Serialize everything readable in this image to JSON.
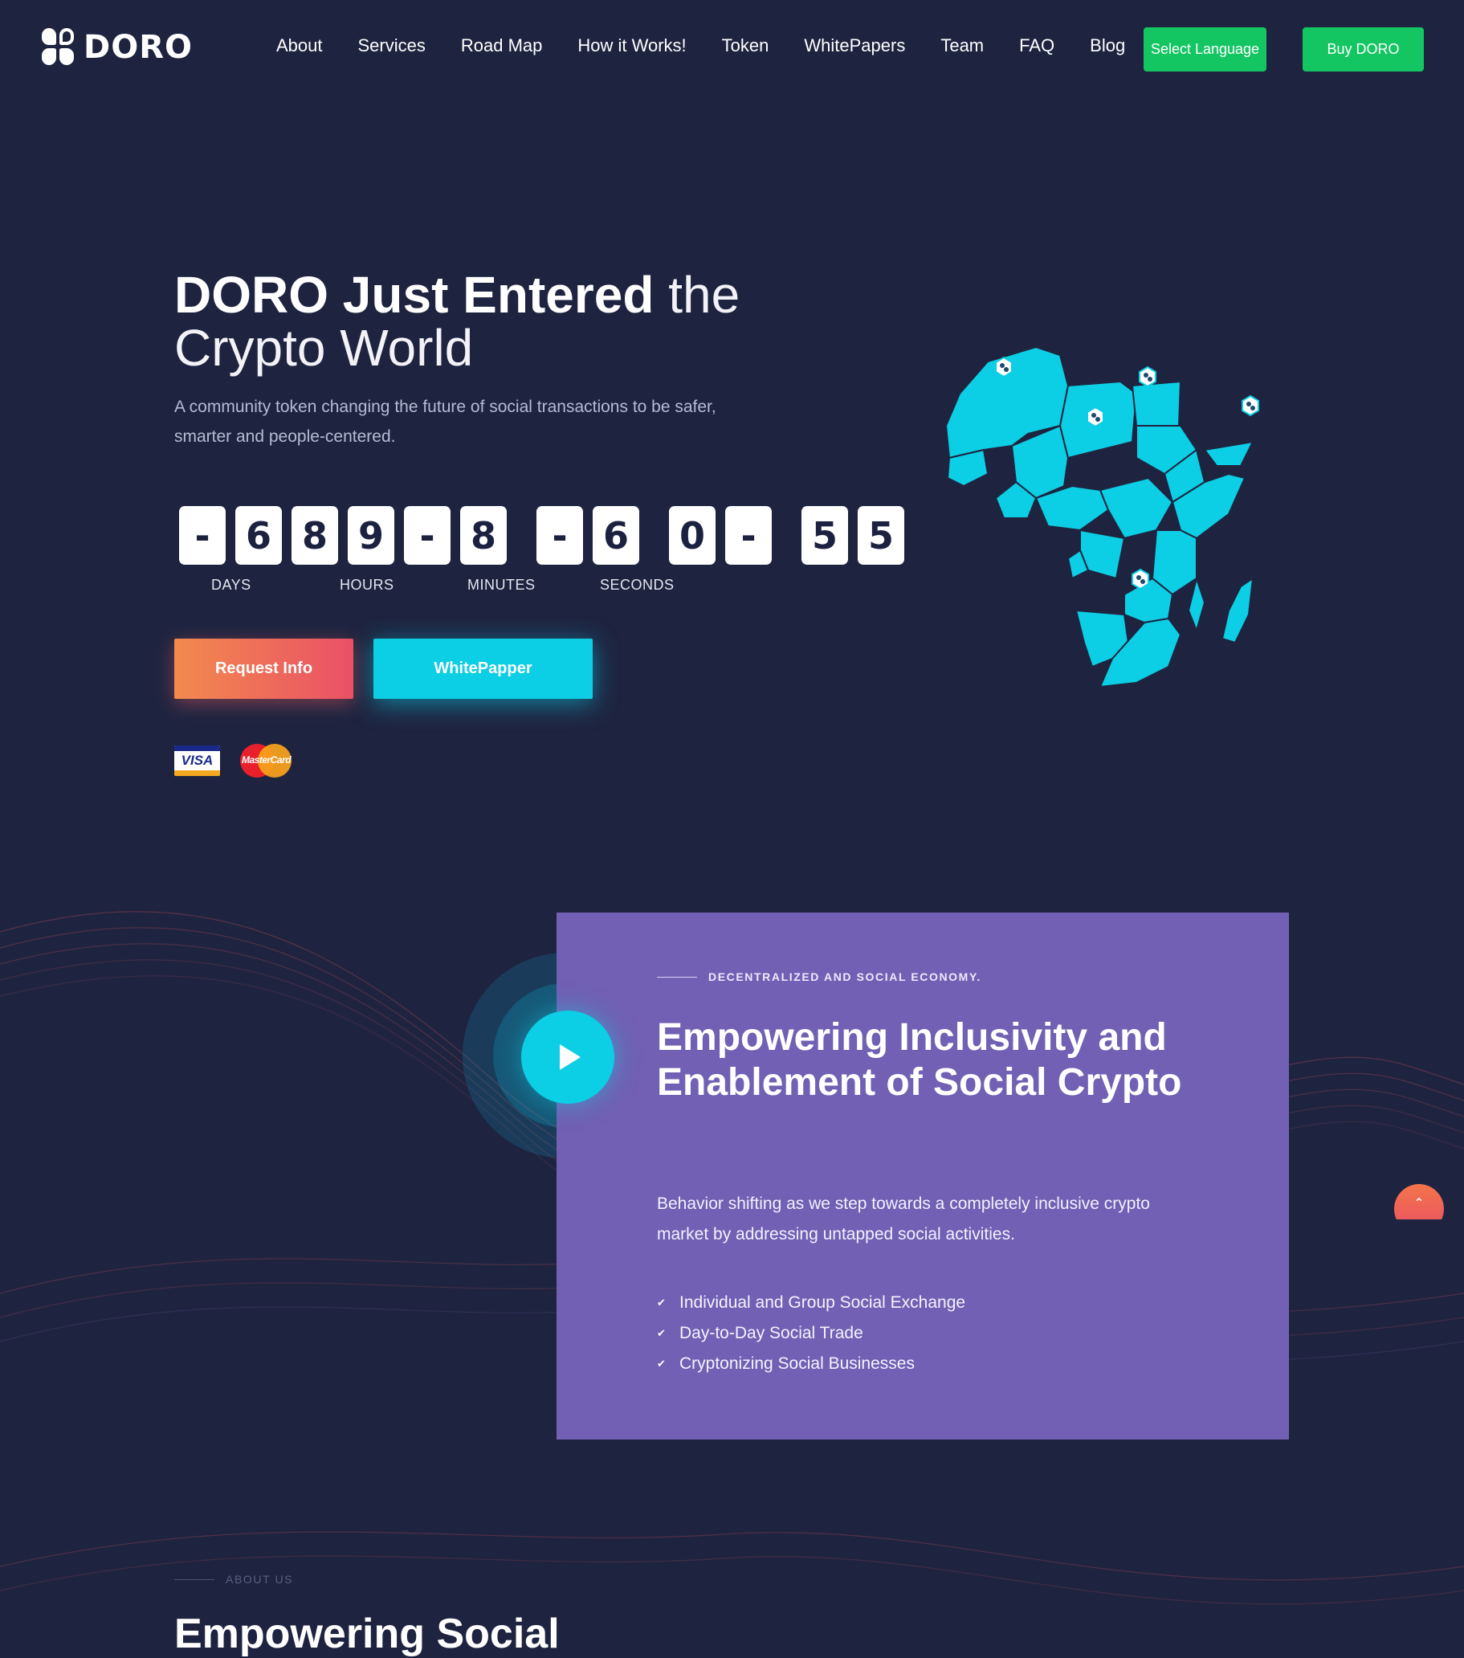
{
  "header": {
    "logo_text": "DORO",
    "nav": [
      "About",
      "Services",
      "Road Map",
      "How it Works!",
      "Token",
      "WhitePapers",
      "Team",
      "FAQ",
      "Blog"
    ],
    "language_button": "Select Language",
    "buy_button": "Buy DORO",
    "accent": "#14c662"
  },
  "hero": {
    "title_bold": "DORO Just Entered",
    "title_light_1": "the",
    "title_light_2": "Crypto World",
    "subtitle": "A community token changing the future of social transactions to be safer, smarter and people-centered.",
    "countdown": {
      "digits": [
        "-",
        "6",
        "8",
        "9",
        "-",
        "8",
        "-",
        "6",
        "0",
        "-",
        "5",
        "5"
      ],
      "labels": [
        "DAYS",
        "HOURS",
        "MINUTES",
        "SECONDS"
      ]
    },
    "request_button": "Request Info",
    "whitepaper_button": "WhitePapper",
    "payment_icons": [
      "visa-icon",
      "mastercard-icon"
    ],
    "visa_text": "VISA",
    "mastercard_text": "MasterCard",
    "map_icon": "africa-map-icon",
    "map_color": "#0ccee4"
  },
  "feature": {
    "eyebrow": "DECENTRALIZED AND SOCIAL ECONOMY.",
    "title": "Empowering Inclusivity and Enablement of Social Crypto",
    "text": "Behavior shifting as we step towards a completely inclusive crypto market by addressing untapped social activities.",
    "items": [
      "Individual and Group Social Exchange",
      "Day-to-Day Social Trade",
      "Cryptonizing Social Businesses"
    ],
    "card_color": "#7160b3",
    "play_icon": "play-icon"
  },
  "about": {
    "eyebrow": "ABOUT US",
    "title": "Empowering Social"
  },
  "scroll_icon": "chevron-up-icon"
}
